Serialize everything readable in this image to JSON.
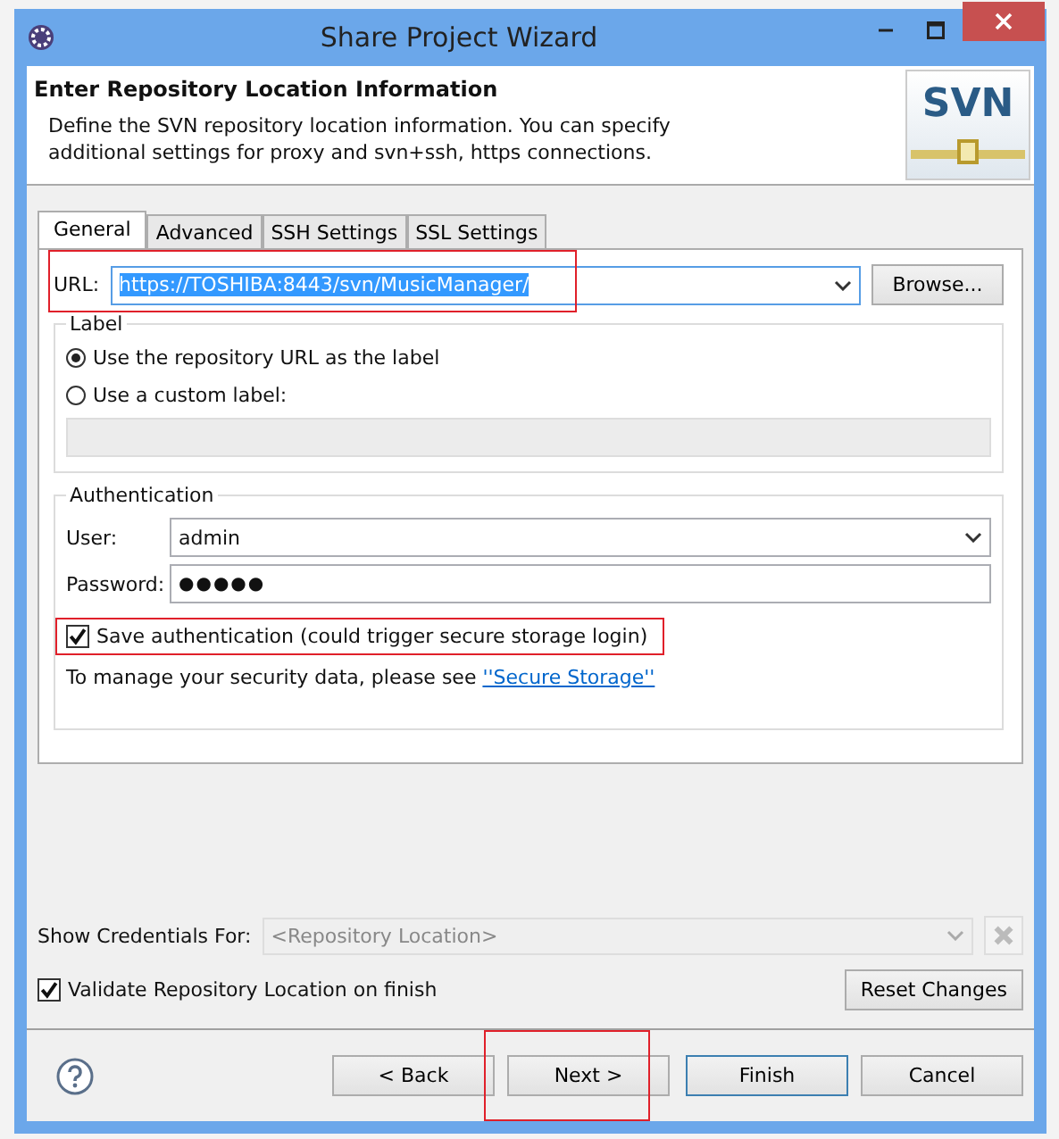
{
  "window": {
    "title": "Share Project Wizard"
  },
  "header": {
    "title": "Enter Repository Location Information",
    "description": "Define the SVN repository location information. You can specify additional settings for proxy and svn+ssh, https connections.",
    "logo_text": "SVN"
  },
  "tabs": [
    {
      "label": "General",
      "selected": true
    },
    {
      "label": "Advanced",
      "selected": false
    },
    {
      "label": "SSH Settings",
      "selected": false
    },
    {
      "label": "SSL Settings",
      "selected": false
    }
  ],
  "url": {
    "label": "URL:",
    "value": "https://TOSHIBA:8443/svn/MusicManager/",
    "browse_button": "Browse..."
  },
  "label_group": {
    "title": "Label",
    "options": [
      {
        "label": "Use the repository URL as the label",
        "selected": true
      },
      {
        "label": "Use a custom label:",
        "selected": false
      }
    ]
  },
  "authentication": {
    "title": "Authentication",
    "user_label": "User:",
    "user": "admin",
    "password_label": "Password:",
    "password": "●●●●●",
    "save": {
      "label": "Save authentication (could trigger secure storage login)",
      "checked": true
    },
    "note": "To manage your security data, please see",
    "link": "''Secure Storage''"
  },
  "credentials": {
    "label": "Show Credentials For:",
    "placeholder": "<Repository Location>",
    "disabled": true
  },
  "validate": {
    "label": "Validate Repository Location on finish",
    "checked": true
  },
  "reset_button": "Reset Changes",
  "buttons": [
    {
      "label": "< Back",
      "default": false
    },
    {
      "label": "Next >",
      "default": false
    },
    {
      "label": "Finish",
      "default": true
    },
    {
      "label": "Cancel",
      "default": false
    }
  ]
}
